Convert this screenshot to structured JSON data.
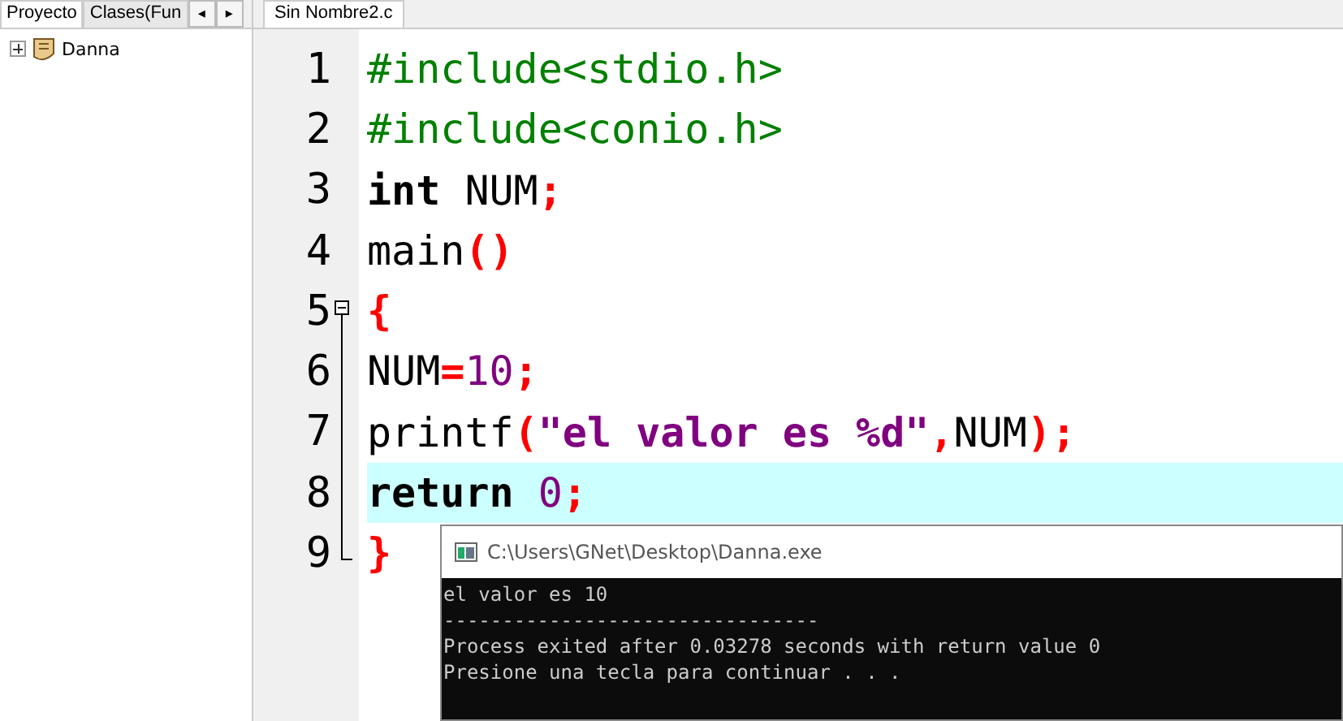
{
  "project_panel": {
    "tabs": [
      {
        "label": "Proyecto",
        "selected": true
      },
      {
        "label": "Clases(Fun",
        "selected": false
      }
    ],
    "scroll_buttons": [
      "◂",
      "▸"
    ],
    "tree": [
      {
        "label": "Danna",
        "expanded": false
      }
    ]
  },
  "editor": {
    "tabs": [
      {
        "label": "Sin Nombre2.c",
        "selected": true
      }
    ],
    "lines": [
      {
        "number": "1",
        "highlighted": false,
        "tokens": [
          {
            "kind": "preproc",
            "text": "#include<stdio.h>"
          }
        ]
      },
      {
        "number": "2",
        "highlighted": false,
        "tokens": [
          {
            "kind": "preproc",
            "text": "#include<conio.h>"
          }
        ]
      },
      {
        "number": "3",
        "highlighted": false,
        "tokens": [
          {
            "kind": "keyword",
            "text": "int"
          },
          {
            "kind": "plain",
            "text": " NUM"
          },
          {
            "kind": "punct",
            "text": ";"
          }
        ]
      },
      {
        "number": "4",
        "highlighted": false,
        "tokens": [
          {
            "kind": "plain",
            "text": "main"
          },
          {
            "kind": "punct",
            "text": "()"
          }
        ]
      },
      {
        "number": "5",
        "highlighted": false,
        "fold_start": {
          "collapsed": false
        },
        "tokens": [
          {
            "kind": "punct",
            "text": "{"
          }
        ]
      },
      {
        "number": "6",
        "highlighted": false,
        "tokens": [
          {
            "kind": "plain",
            "text": "NUM"
          },
          {
            "kind": "punct",
            "text": "="
          },
          {
            "kind": "number",
            "text": "10"
          },
          {
            "kind": "punct",
            "text": ";"
          }
        ]
      },
      {
        "number": "7",
        "highlighted": false,
        "tokens": [
          {
            "kind": "plain",
            "text": "printf"
          },
          {
            "kind": "punct",
            "text": "("
          },
          {
            "kind": "string",
            "text": "\"el valor es %d\""
          },
          {
            "kind": "punct",
            "text": ","
          },
          {
            "kind": "plain",
            "text": "NUM"
          },
          {
            "kind": "punct",
            "text": ");"
          }
        ]
      },
      {
        "number": "8",
        "highlighted": true,
        "tokens": [
          {
            "kind": "keyword",
            "text": "return"
          },
          {
            "kind": "number",
            "text": " 0"
          },
          {
            "kind": "punct",
            "text": ";"
          }
        ]
      },
      {
        "number": "9",
        "highlighted": false,
        "fold_end": true,
        "tokens": [
          {
            "kind": "punct",
            "text": "}"
          }
        ]
      }
    ]
  },
  "console": {
    "title": "C:\\Users\\GNet\\Desktop\\Danna.exe",
    "output": [
      "el valor es 10",
      "--------------------------------",
      "Process exited after 0.03278 seconds with return value 0",
      "Presione una tecla para continuar . . ."
    ]
  }
}
